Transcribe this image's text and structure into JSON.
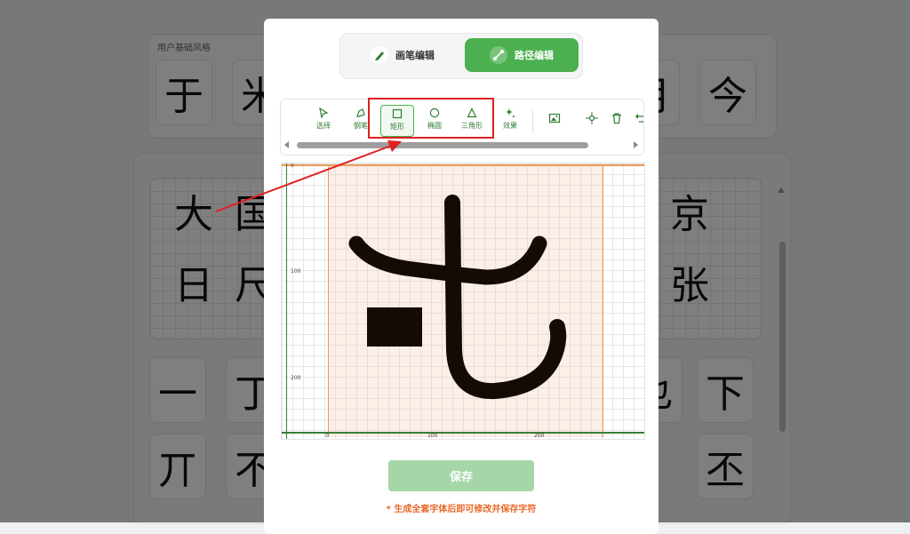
{
  "background": {
    "base_style_label": "用户基础风格",
    "base_chars": [
      "于",
      "米",
      "",
      "",
      "",
      "",
      "",
      "",
      "",
      "月",
      "今"
    ],
    "grid_chars": [
      "大",
      "国",
      "",
      "",
      "",
      "",
      "",
      "",
      "",
      "",
      "京",
      "日",
      "尺",
      "",
      "",
      "",
      "",
      "",
      "",
      "",
      "",
      "张"
    ],
    "cell_chars": [
      "一",
      "丁",
      "",
      "",
      "",
      "",
      "",
      "",
      "乜",
      "下",
      "丌",
      "不",
      "",
      "",
      "",
      "",
      "",
      "",
      "",
      "丕"
    ]
  },
  "modal": {
    "modes": [
      {
        "label": "画笔编辑",
        "icon": "pen-icon",
        "active": false
      },
      {
        "label": "路径编辑",
        "icon": "path-icon",
        "active": true
      }
    ],
    "tools": [
      {
        "label": "选择",
        "icon": "select-cursor-icon"
      },
      {
        "label": "钢笔",
        "icon": "pen-nib-icon"
      },
      {
        "label": "矩形",
        "icon": "rectangle-icon"
      },
      {
        "label": "椭圆",
        "icon": "ellipse-icon"
      },
      {
        "label": "三角形",
        "icon": "triangle-icon"
      },
      {
        "label": "效果",
        "icon": "sparkle-icon"
      }
    ],
    "icon_tools": [
      "image-icon",
      "crosshair-icon",
      "trash-icon",
      "undo-icon"
    ],
    "ticks": {
      "y": [
        "0",
        "100",
        "200"
      ],
      "x": [
        "0",
        "100",
        "200"
      ]
    },
    "save_label": "保存",
    "hint": "* 生成全套字体后即可修改并保存字符"
  },
  "colors": {
    "accent": "#4caf50",
    "highlight": "#e02020",
    "hint": "#e8692a"
  }
}
